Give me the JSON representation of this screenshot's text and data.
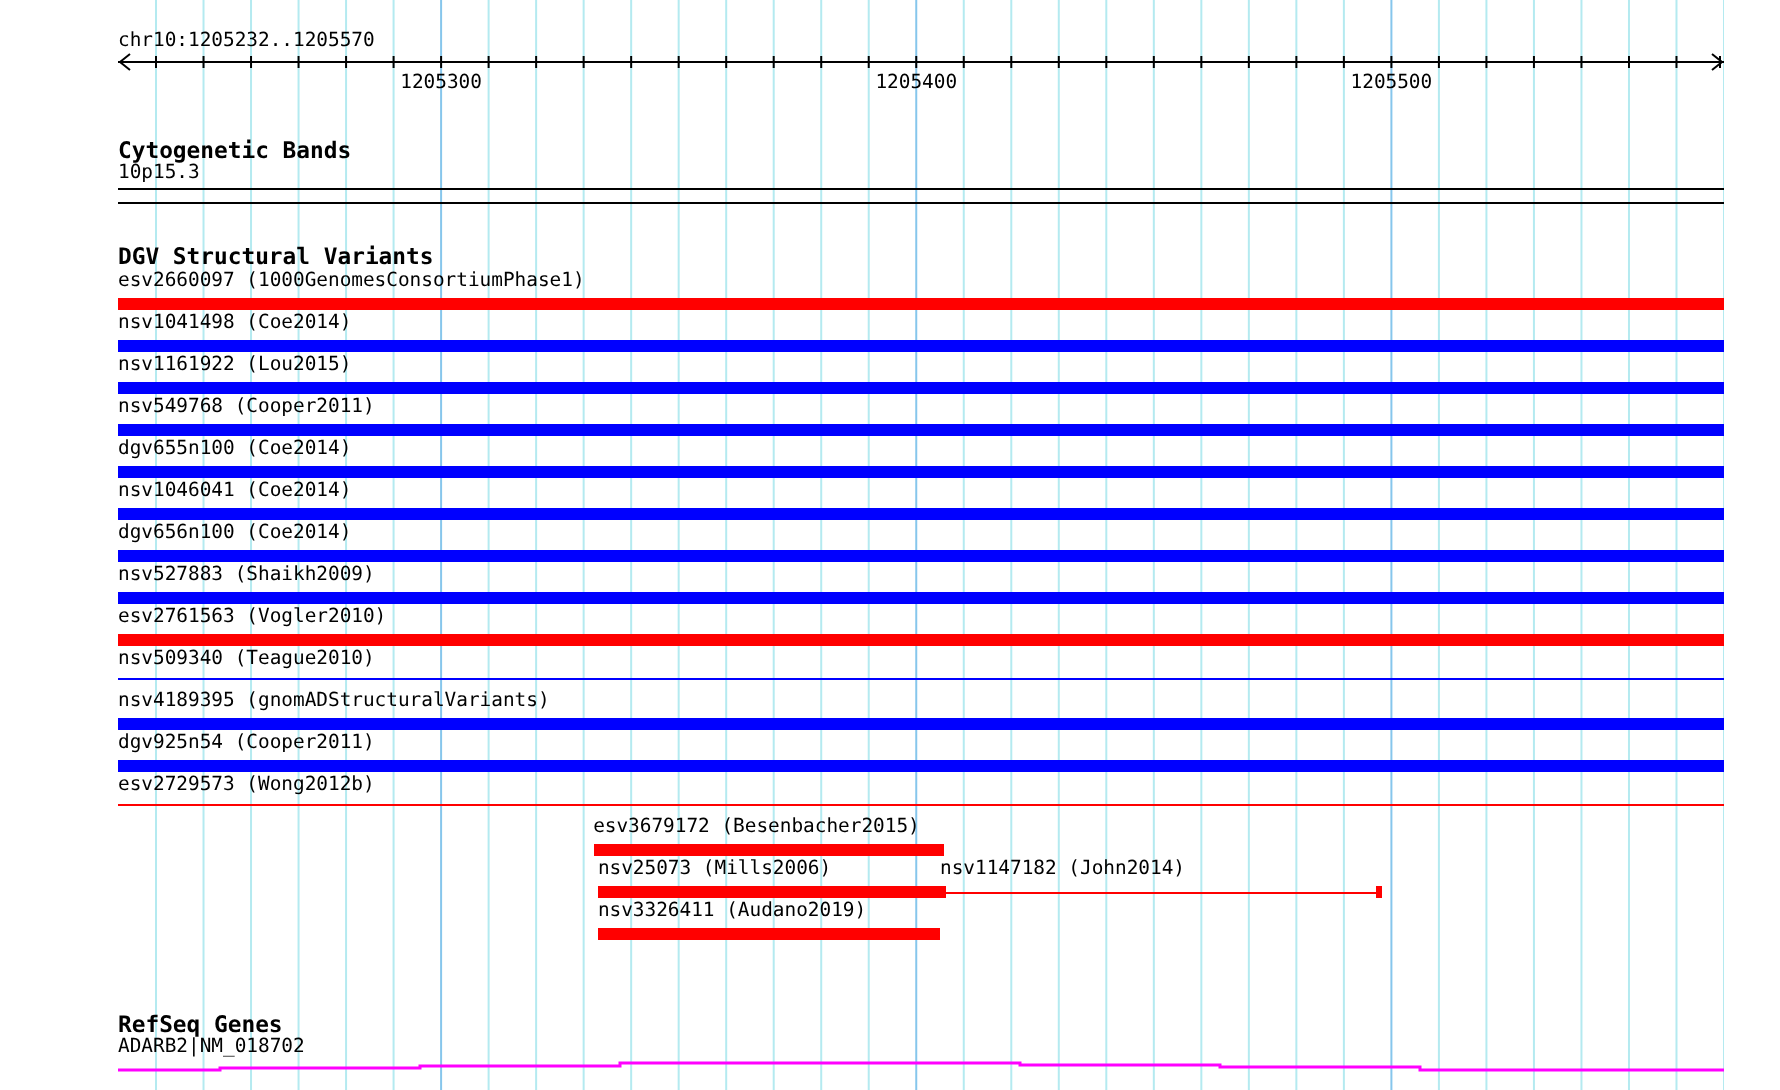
{
  "ruler": {
    "location": "chr10:1205232..1205570",
    "ticks": [
      "1205300",
      "1205400",
      "1205500"
    ]
  },
  "tracks": [
    {
      "kind": "bands",
      "title": "Cytogenetic Bands",
      "label": "10p15.3"
    },
    {
      "kind": "variants",
      "title": "DGV Structural Variants",
      "rows": [
        {
          "features": [
            {
              "label": "esv2660097 (1000GenomesConsortiumPhase1)",
              "color": "#ff0000",
              "kind": "thick"
            }
          ]
        },
        {
          "features": [
            {
              "label": "nsv1041498 (Coe2014)",
              "color": "#0000ff",
              "kind": "thick"
            }
          ]
        },
        {
          "features": [
            {
              "label": "nsv1161922 (Lou2015)",
              "color": "#0000ff",
              "kind": "thick"
            }
          ]
        },
        {
          "features": [
            {
              "label": "nsv549768 (Cooper2011)",
              "color": "#0000ff",
              "kind": "thick"
            }
          ]
        },
        {
          "features": [
            {
              "label": "dgv655n100 (Coe2014)",
              "color": "#0000ff",
              "kind": "thick"
            }
          ]
        },
        {
          "features": [
            {
              "label": "nsv1046041 (Coe2014)",
              "color": "#0000ff",
              "kind": "thick"
            }
          ]
        },
        {
          "features": [
            {
              "label": "dgv656n100 (Coe2014)",
              "color": "#0000ff",
              "kind": "thick"
            }
          ]
        },
        {
          "features": [
            {
              "label": "nsv527883 (Shaikh2009)",
              "color": "#0000ff",
              "kind": "thick"
            }
          ]
        },
        {
          "features": [
            {
              "label": "esv2761563 (Vogler2010)",
              "color": "#ff0000",
              "kind": "thick"
            }
          ]
        },
        {
          "features": [
            {
              "label": "nsv509340 (Teague2010)",
              "color": "#0000ff",
              "kind": "thin"
            }
          ]
        },
        {
          "features": [
            {
              "label": "nsv4189395 (gnomADStructuralVariants)",
              "color": "#0000ff",
              "kind": "thick"
            }
          ]
        },
        {
          "features": [
            {
              "label": "dgv925n54 (Cooper2011)",
              "color": "#0000ff",
              "kind": "thick"
            }
          ]
        },
        {
          "features": [
            {
              "label": "esv2729573 (Wong2012b)",
              "color": "#ff0000",
              "kind": "thin"
            }
          ]
        },
        {
          "features": [
            {
              "label": "esv3679172 (Besenbacher2015)",
              "color": "#ff0000",
              "kind": "thick"
            }
          ]
        },
        {
          "features": [
            {
              "label": "nsv25073 (Mills2006)",
              "color": "#ff0000",
              "kind": "thick"
            },
            {
              "label": "nsv1147182 (John2014)",
              "color": "#ff0000",
              "kind": "split"
            }
          ]
        },
        {
          "features": [
            {
              "label": "nsv3326411 (Audano2019)",
              "color": "#ff0000",
              "kind": "thick"
            }
          ]
        }
      ]
    },
    {
      "kind": "genes",
      "title": "RefSeq Genes",
      "label": "ADARB2|NM_018702"
    }
  ]
}
